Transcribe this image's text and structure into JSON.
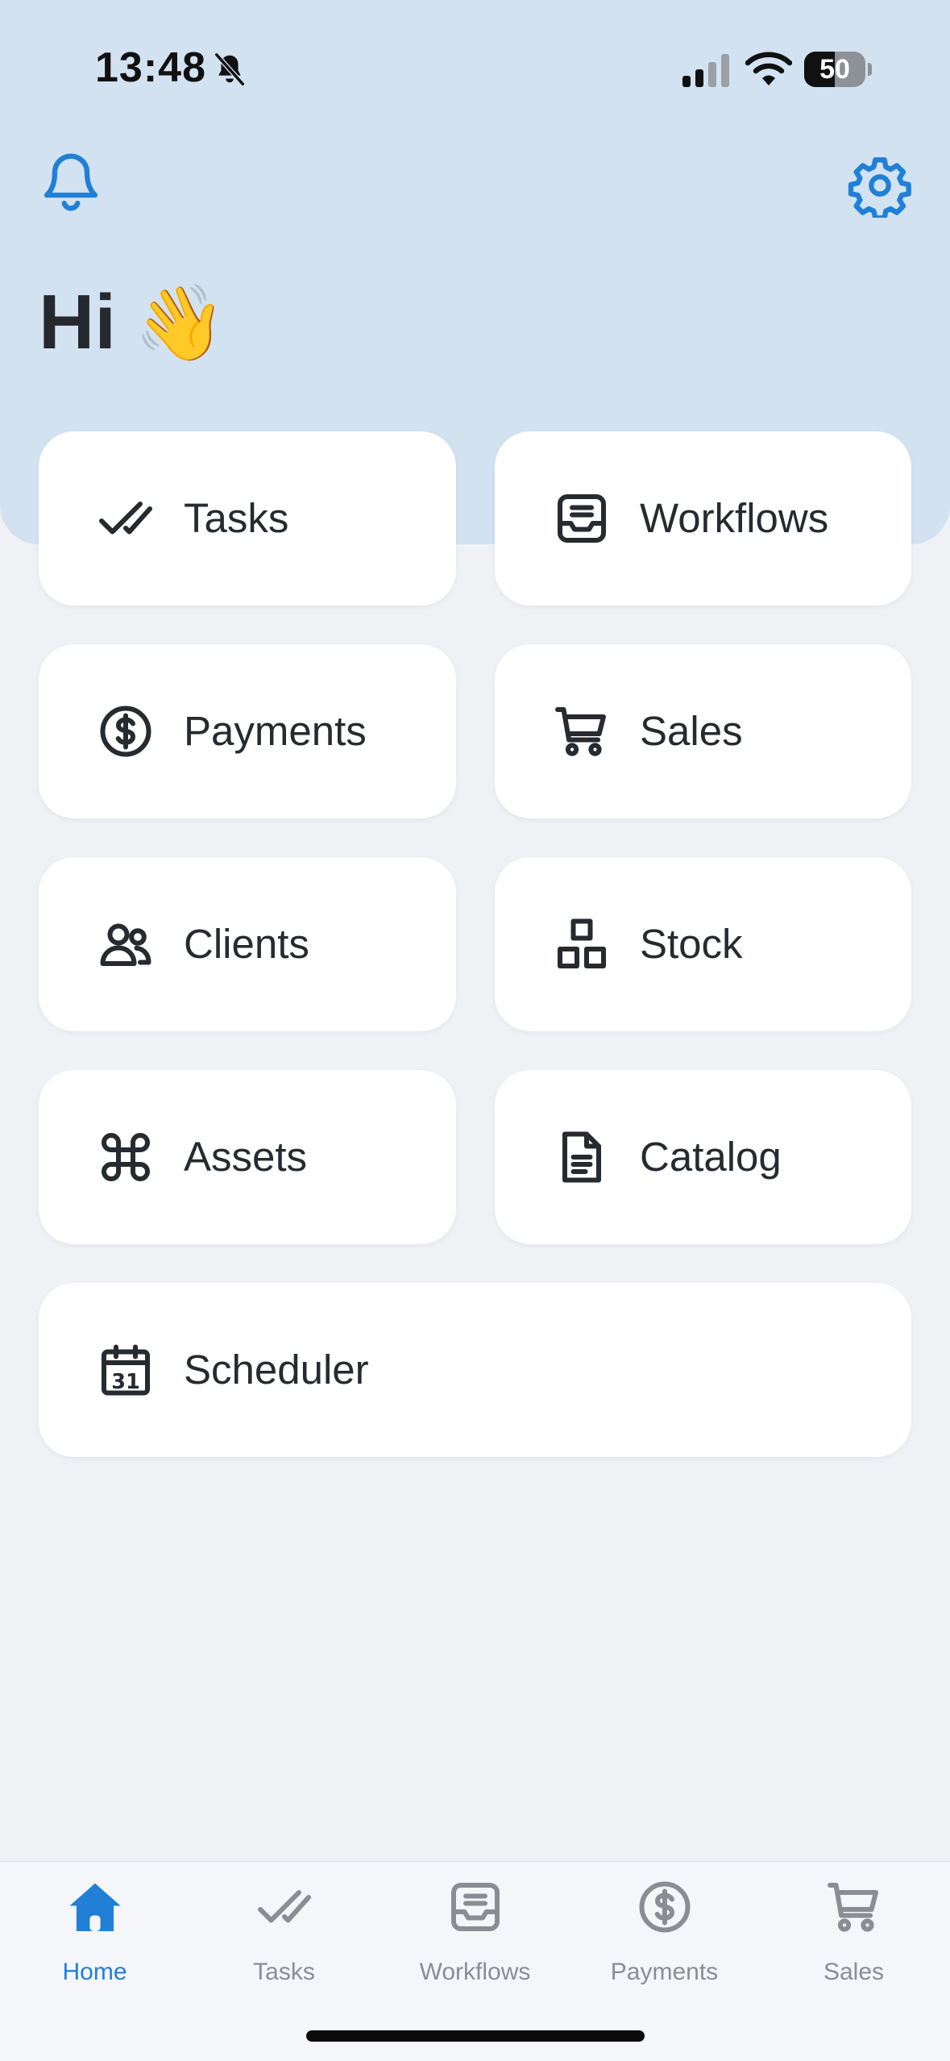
{
  "status_bar": {
    "time": "13:48",
    "battery_level": "50",
    "battery_fraction": 0.5,
    "icons": [
      "silent-mode-icon",
      "cellular-signal-icon",
      "wifi-icon",
      "battery-icon"
    ]
  },
  "header": {
    "left_icon": "bell-icon",
    "right_icon": "gear-icon",
    "greeting": "Hi",
    "greeting_emoji": "👋",
    "accent_color": "#2180d6",
    "band_color": "#d2e2f1"
  },
  "tiles": [
    {
      "label": "Tasks",
      "icon": "checkmark-icon"
    },
    {
      "label": "Workflows",
      "icon": "inbox-icon"
    },
    {
      "label": "Payments",
      "icon": "dollar-circle-icon"
    },
    {
      "label": "Sales",
      "icon": "cart-icon"
    },
    {
      "label": "Clients",
      "icon": "users-icon"
    },
    {
      "label": "Stock",
      "icon": "boxes-icon"
    },
    {
      "label": "Assets",
      "icon": "command-icon"
    },
    {
      "label": "Catalog",
      "icon": "document-icon"
    },
    {
      "label": "Scheduler",
      "icon": "calendar-icon"
    }
  ],
  "tab_bar": {
    "items": [
      {
        "label": "Home",
        "icon": "home-icon",
        "active": true
      },
      {
        "label": "Tasks",
        "icon": "checkmark-icon",
        "active": false
      },
      {
        "label": "Workflows",
        "icon": "inbox-icon",
        "active": false
      },
      {
        "label": "Payments",
        "icon": "dollar-circle-icon",
        "active": false
      },
      {
        "label": "Sales",
        "icon": "cart-icon",
        "active": false
      }
    ],
    "active_color": "#2180d6",
    "inactive_color": "#8a8d93"
  }
}
